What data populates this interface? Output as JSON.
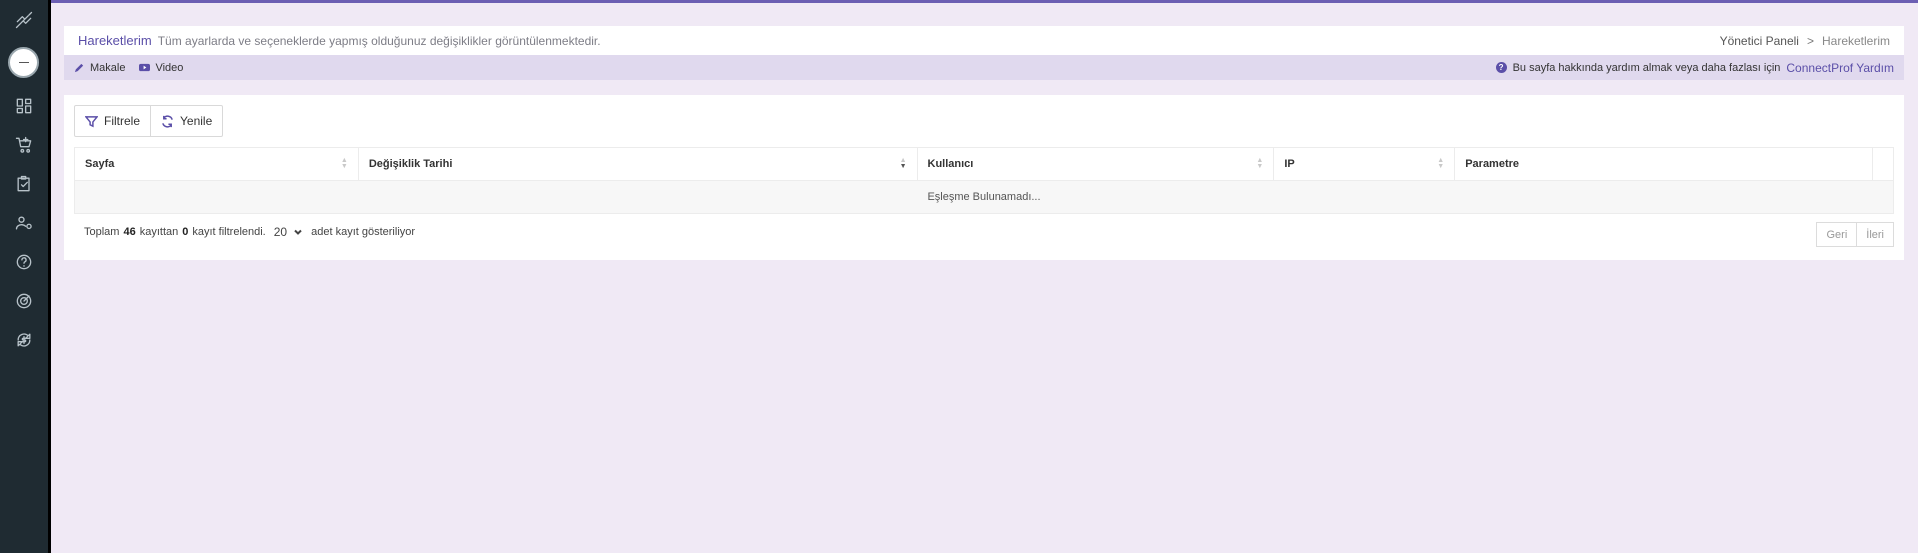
{
  "header": {
    "title": "Hareketlerim",
    "subtitle": "Tüm ayarlarda ve seçeneklerde yapmış olduğunuz değişiklikler görüntülenmektedir.",
    "breadcrumb": [
      "Yönetici Paneli",
      "Hareketlerim"
    ],
    "breadcrumb_sep": ">"
  },
  "helpbar": {
    "article_label": "Makale",
    "video_label": "Video",
    "help_text": "Bu sayfa hakkında yardım almak veya daha fazlası için",
    "help_link": "ConnectProf Yardım"
  },
  "toolbar": {
    "filter_label": "Filtrele",
    "refresh_label": "Yenile"
  },
  "table": {
    "columns": [
      "Sayfa",
      "Değişiklik Tarihi",
      "Kullanıcı",
      "IP",
      "Parametre"
    ],
    "empty_text": "Eşleşme Bulunamadı..."
  },
  "footer": {
    "prefix": "Toplam",
    "total": "46",
    "mid": "kayıttan",
    "filtered": "0",
    "suffix": "kayıt filtrelendi.",
    "page_size": "20",
    "page_size_suffix": "adet kayıt gösteriliyor"
  },
  "pager": {
    "prev_label": "Geri",
    "next_label": "İleri"
  },
  "sidebar": {
    "icons": [
      "logo-icon",
      "dashboard-icon",
      "cart-icon",
      "clipboard-check-icon",
      "user-settings-icon",
      "help-icon",
      "radar-icon",
      "sync-dollar-icon"
    ]
  },
  "colors": {
    "accent": "#5b4fa8",
    "sidebar_bg": "#1f2b32",
    "page_bg": "#f0e9f5"
  }
}
